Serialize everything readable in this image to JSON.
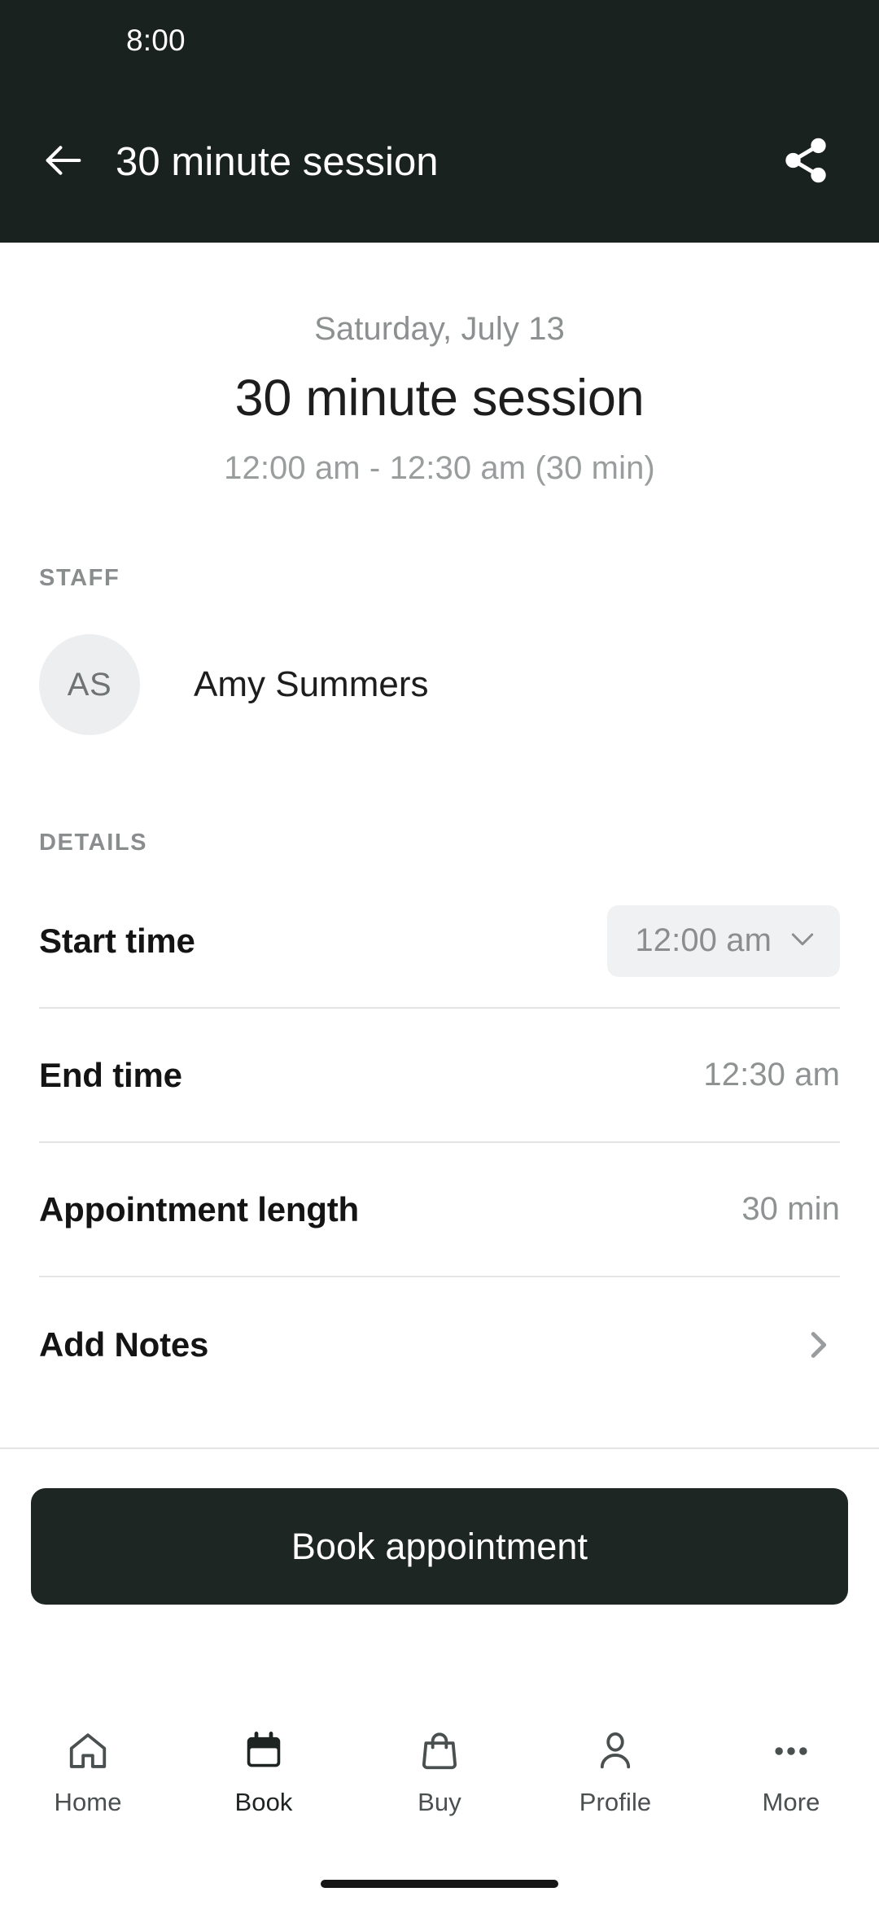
{
  "status_bar": {
    "time": "8:00"
  },
  "app_bar": {
    "back_icon": "arrow-left-icon",
    "title": "30 minute session",
    "share_icon": "share-icon"
  },
  "hero": {
    "date": "Saturday, July 13",
    "title": "30 minute session",
    "time_range": "12:00 am - 12:30 am (30 min)"
  },
  "staff": {
    "section_label": "STAFF",
    "member": {
      "initials": "AS",
      "name": "Amy Summers"
    }
  },
  "details": {
    "section_label": "DETAILS",
    "rows": [
      {
        "label": "Start time",
        "value": "12:00 am",
        "control": "dropdown",
        "icon": "chevron-down-icon"
      },
      {
        "label": "End time",
        "value": "12:30 am",
        "control": "text"
      },
      {
        "label": "Appointment length",
        "value": "30 min",
        "control": "text"
      },
      {
        "label": "Add Notes",
        "value": "",
        "control": "navigate",
        "icon": "chevron-right-icon"
      }
    ]
  },
  "cta": {
    "label": "Book appointment"
  },
  "bottom_nav": {
    "items": [
      {
        "label": "Home",
        "icon": "home-icon",
        "active": false
      },
      {
        "label": "Book",
        "icon": "calendar-icon",
        "active": true
      },
      {
        "label": "Buy",
        "icon": "shopping-bag-icon",
        "active": false
      },
      {
        "label": "Profile",
        "icon": "person-icon",
        "active": false
      },
      {
        "label": "More",
        "icon": "more-horizontal-icon",
        "active": false
      }
    ]
  },
  "colors": {
    "header_background": "#1a2220",
    "cta_background": "#1e2624",
    "chip_background": "#f0f1f2",
    "avatar_background": "#eceeef",
    "divider": "#e2e4e5",
    "muted_text": "#8f9293",
    "primary_text": "#141414"
  }
}
